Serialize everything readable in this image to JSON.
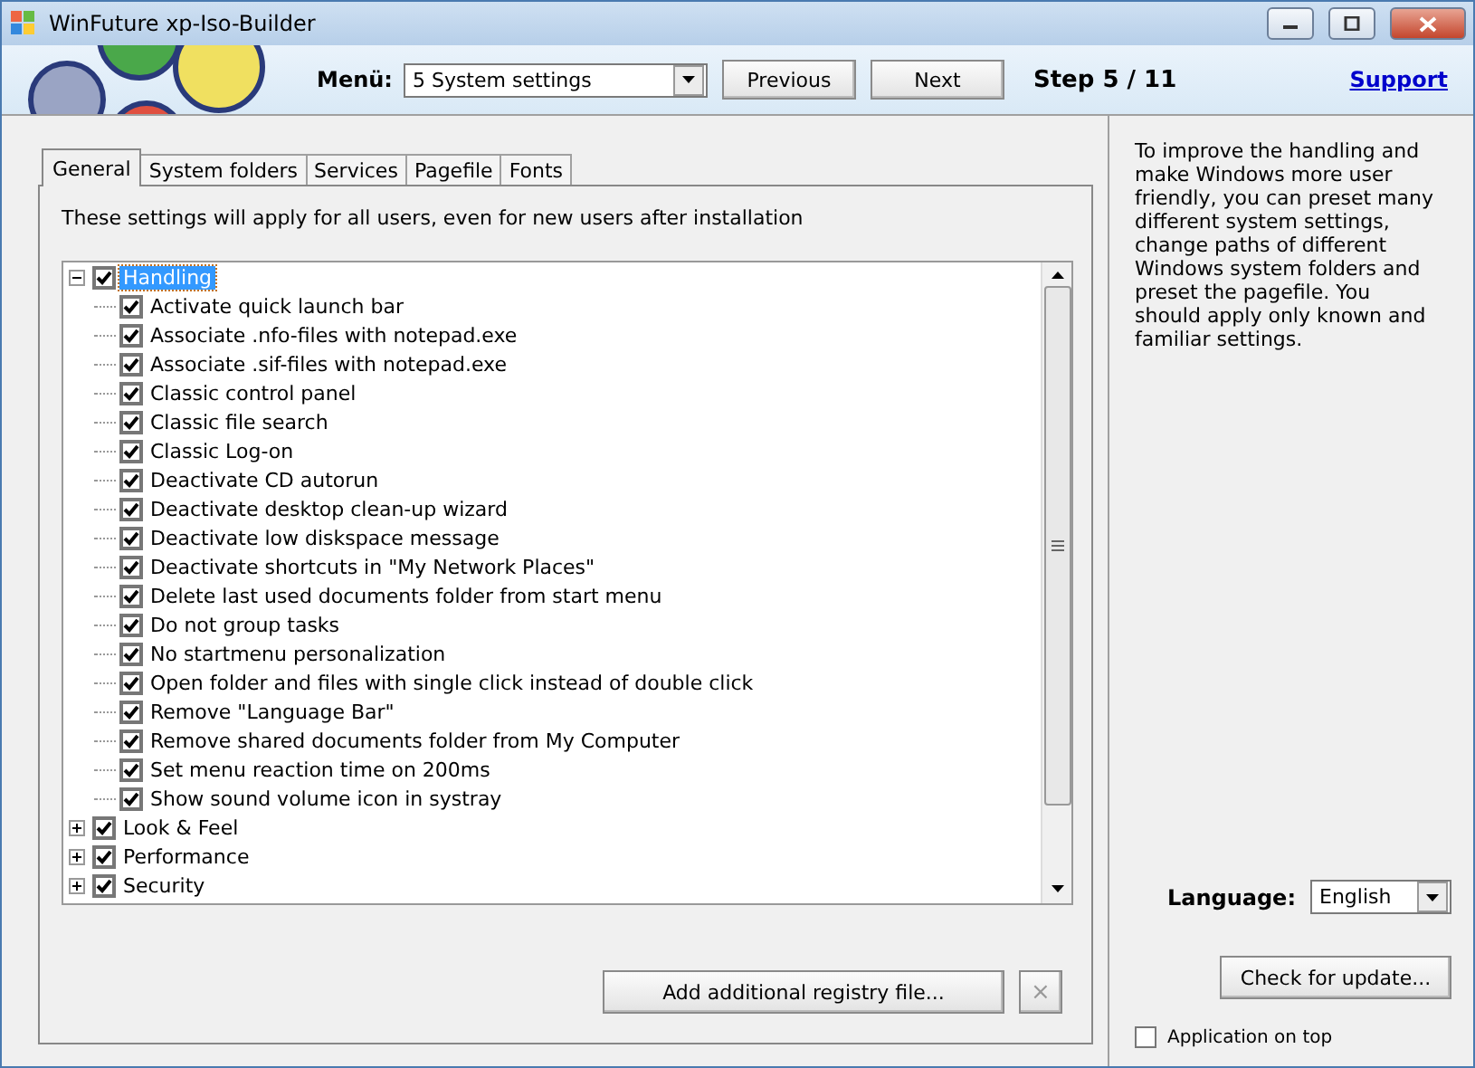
{
  "window": {
    "title": "WinFuture xp-Iso-Builder"
  },
  "header": {
    "menu_label": "Menü:",
    "menu_value": "5 System settings",
    "previous": "Previous",
    "next": "Next",
    "step": "Step 5 / 11",
    "support": "Support"
  },
  "tabs": [
    {
      "label": "General",
      "selected": true
    },
    {
      "label": "System folders",
      "selected": false
    },
    {
      "label": "Services",
      "selected": false
    },
    {
      "label": "Pagefile",
      "selected": false
    },
    {
      "label": "Fonts",
      "selected": false
    }
  ],
  "intro": "These settings will apply for all users, even for new users after installation",
  "tree": [
    {
      "label": "Handling",
      "checked": true,
      "expanded": true,
      "selected": true,
      "children": [
        {
          "label": "Activate quick launch bar",
          "checked": true
        },
        {
          "label": "Associate .nfo-files with notepad.exe",
          "checked": true
        },
        {
          "label": "Associate .sif-files with notepad.exe",
          "checked": true
        },
        {
          "label": "Classic control panel",
          "checked": true
        },
        {
          "label": "Classic file search",
          "checked": true
        },
        {
          "label": "Classic Log-on",
          "checked": true
        },
        {
          "label": "Deactivate CD autorun",
          "checked": true
        },
        {
          "label": "Deactivate desktop clean-up wizard",
          "checked": true
        },
        {
          "label": "Deactivate low diskspace message",
          "checked": true
        },
        {
          "label": "Deactivate shortcuts in \"My Network Places\"",
          "checked": true
        },
        {
          "label": "Delete last used documents folder from start menu",
          "checked": true
        },
        {
          "label": "Do not group tasks",
          "checked": true
        },
        {
          "label": "No startmenu personalization",
          "checked": true
        },
        {
          "label": "Open folder and files with single click instead of double click",
          "checked": true
        },
        {
          "label": "Remove \"Language Bar\"",
          "checked": true
        },
        {
          "label": "Remove shared documents folder from My Computer",
          "checked": true
        },
        {
          "label": "Set menu reaction time on 200ms",
          "checked": true
        },
        {
          "label": "Show sound volume icon in systray",
          "checked": true
        }
      ]
    },
    {
      "label": "Look & Feel",
      "checked": true,
      "expanded": false,
      "selected": false
    },
    {
      "label": "Performance",
      "checked": true,
      "expanded": false,
      "selected": false
    },
    {
      "label": "Security",
      "checked": true,
      "expanded": false,
      "selected": false
    }
  ],
  "add_button": "Add additional registry file...",
  "remove_button": {
    "label": "×",
    "disabled": true
  },
  "side_text": "To improve the handling and make Windows more user friendly, you can preset many different system settings, change paths of different Windows system folders and preset the pagefile. You should apply only known and familiar settings.",
  "language": {
    "label": "Language:",
    "value": "English"
  },
  "update_button": "Check for update...",
  "on_top": {
    "label": "Application on top",
    "checked": false
  }
}
